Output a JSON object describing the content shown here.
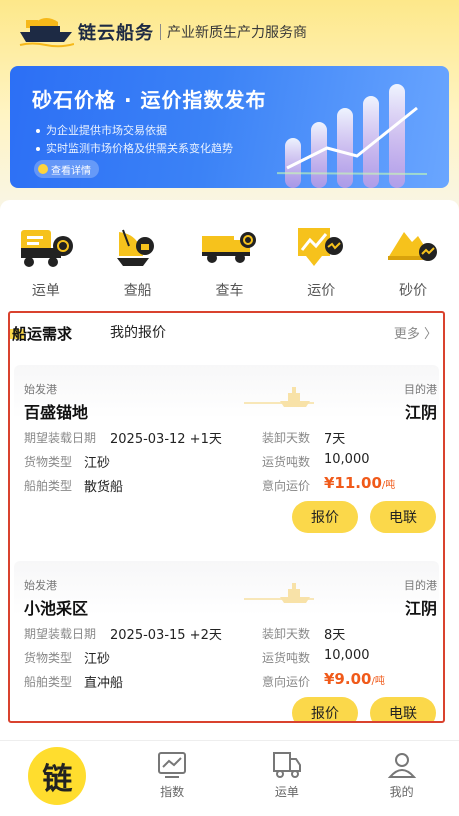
{
  "header": {
    "brand": "链云船务",
    "slogan": "产业新质生产力服务商"
  },
  "banner": {
    "title": "砂石价格 · 运价指数发布",
    "line1": "为企业提供市场交易依据",
    "line2": "实时监测市场价格及供需关系变化趋势",
    "detail": "查看详情"
  },
  "quick": [
    {
      "label": "运单"
    },
    {
      "label": "查船"
    },
    {
      "label": "查车"
    },
    {
      "label": "运价"
    },
    {
      "label": "砂价"
    }
  ],
  "section": {
    "tab_active": "船运需求",
    "tab_other": "我的报价",
    "more": "更多 〉"
  },
  "labels": {
    "from": "始发港",
    "to": "目的港",
    "load_date": "期望装载日期",
    "cargo": "货物类型",
    "ship_type": "船舶类型",
    "days": "装卸天数",
    "tons": "运货吨数",
    "price": "意向运价",
    "quote_btn": "报价",
    "call_btn": "电联",
    "unit": "/吨"
  },
  "orders": [
    {
      "from": "百盛锚地",
      "to": "江阴",
      "load_date": "2025-03-12 +1天",
      "cargo": "江砂",
      "ship_type": "散货船",
      "days": "7天",
      "tons": "10,000",
      "price": "¥11.00"
    },
    {
      "from": "小池采区",
      "to": "江阴",
      "load_date": "2025-03-15 +2天",
      "cargo": "江砂",
      "ship_type": "直冲船",
      "days": "8天",
      "tons": "10,000",
      "price": "¥9.00"
    }
  ],
  "tabbar": [
    {
      "label": "链",
      "icon": "home-logo-icon"
    },
    {
      "label": "指数",
      "icon": "chart-icon"
    },
    {
      "label": "运单",
      "icon": "truck-icon"
    },
    {
      "label": "我的",
      "icon": "user-icon"
    }
  ],
  "colors": {
    "accent": "#fbd84a",
    "price": "#f05a1a",
    "banner": "#3b82f6",
    "highlight_border": "#d9422e"
  }
}
